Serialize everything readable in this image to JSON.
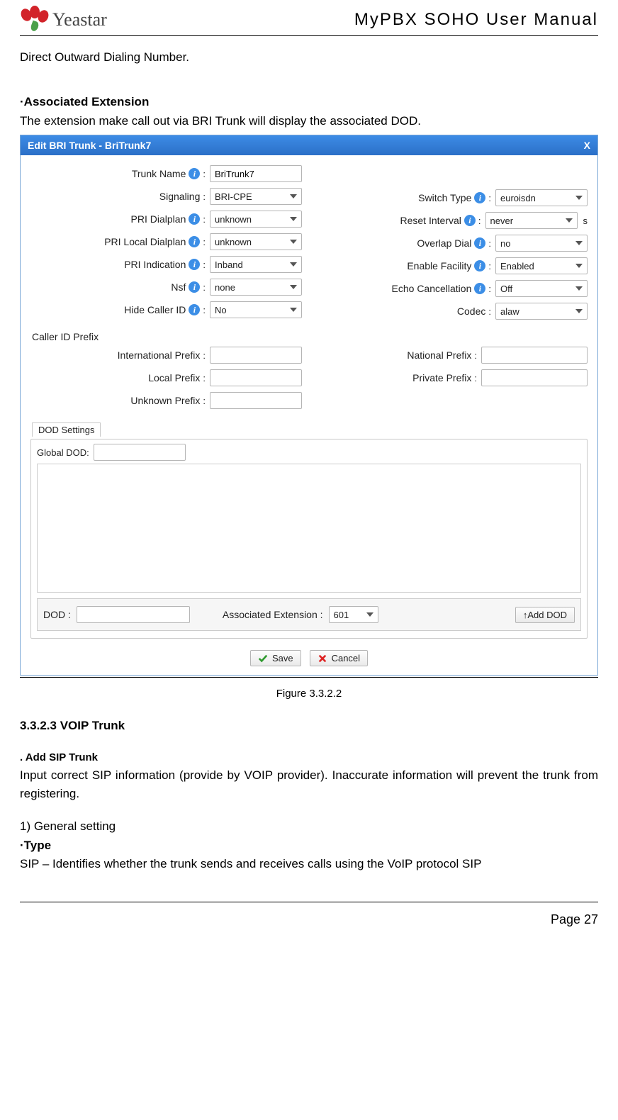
{
  "header": {
    "brand": "Yeastar",
    "doc_title": "MyPBX SOHO User Manual"
  },
  "text": {
    "intro_line": "Direct Outward Dialing Number.",
    "assoc_ext_heading": "·Associated Extension",
    "assoc_ext_body": "The extension make call out via BRI Trunk will display the associated DOD."
  },
  "dialog": {
    "title": "Edit BRI Trunk - BriTrunk7",
    "close": "X",
    "left": [
      {
        "label": "Trunk Name",
        "info": true,
        "type": "text",
        "value": "BriTrunk7"
      },
      {
        "label": "Signaling",
        "info": false,
        "type": "select",
        "value": "BRI-CPE"
      },
      {
        "label": "PRI Dialplan",
        "info": true,
        "type": "select",
        "value": "unknown"
      },
      {
        "label": "PRI Local Dialplan",
        "info": true,
        "type": "select",
        "value": "unknown"
      },
      {
        "label": "PRI Indication",
        "info": true,
        "type": "select",
        "value": "Inband"
      },
      {
        "label": "Nsf",
        "info": true,
        "type": "select",
        "value": "none"
      },
      {
        "label": "Hide Caller ID",
        "info": true,
        "type": "select",
        "value": "No"
      }
    ],
    "right": [
      {
        "label": "Switch Type",
        "info": true,
        "type": "select",
        "value": "euroisdn"
      },
      {
        "label": "Reset Interval",
        "info": true,
        "type": "select",
        "value": "never",
        "after": "s"
      },
      {
        "label": "Overlap Dial",
        "info": true,
        "type": "select",
        "value": "no"
      },
      {
        "label": "Enable Facility",
        "info": true,
        "type": "select",
        "value": "Enabled"
      },
      {
        "label": "Echo Cancellation",
        "info": true,
        "type": "select",
        "value": "Off"
      },
      {
        "label": "Codec",
        "info": false,
        "type": "select",
        "value": "alaw"
      }
    ],
    "cid": {
      "heading": "Caller ID Prefix",
      "rows_left": [
        {
          "label": "International Prefix",
          "value": ""
        },
        {
          "label": "Local Prefix",
          "value": ""
        },
        {
          "label": "Unknown Prefix",
          "value": ""
        }
      ],
      "rows_right": [
        {
          "label": "National Prefix",
          "value": ""
        },
        {
          "label": "Private Prefix",
          "value": ""
        }
      ]
    },
    "dod": {
      "fieldset_label": "DOD Settings",
      "global_label": "Global DOD:",
      "global_value": "",
      "add": {
        "dod_label": "DOD :",
        "dod_value": "",
        "assoc_label": "Associated Extension :",
        "assoc_value": "601",
        "button": "↑Add DOD"
      }
    },
    "footer": {
      "save": "Save",
      "cancel": "Cancel"
    }
  },
  "figure_caption": "Figure 3.3.2.2",
  "section": {
    "voip_heading": "3.3.2.3 VOIP Trunk",
    "add_sip_heading": ". Add SIP Trunk",
    "add_sip_body": "Input correct SIP information (provide by VOIP provider). Inaccurate information will prevent the trunk from registering.",
    "general_heading": "1) General setting",
    "type_heading": "·Type",
    "type_body": "SIP – Identifies whether the trunk sends and receives calls using the VoIP protocol SIP"
  },
  "footer": {
    "page": "Page 27"
  }
}
